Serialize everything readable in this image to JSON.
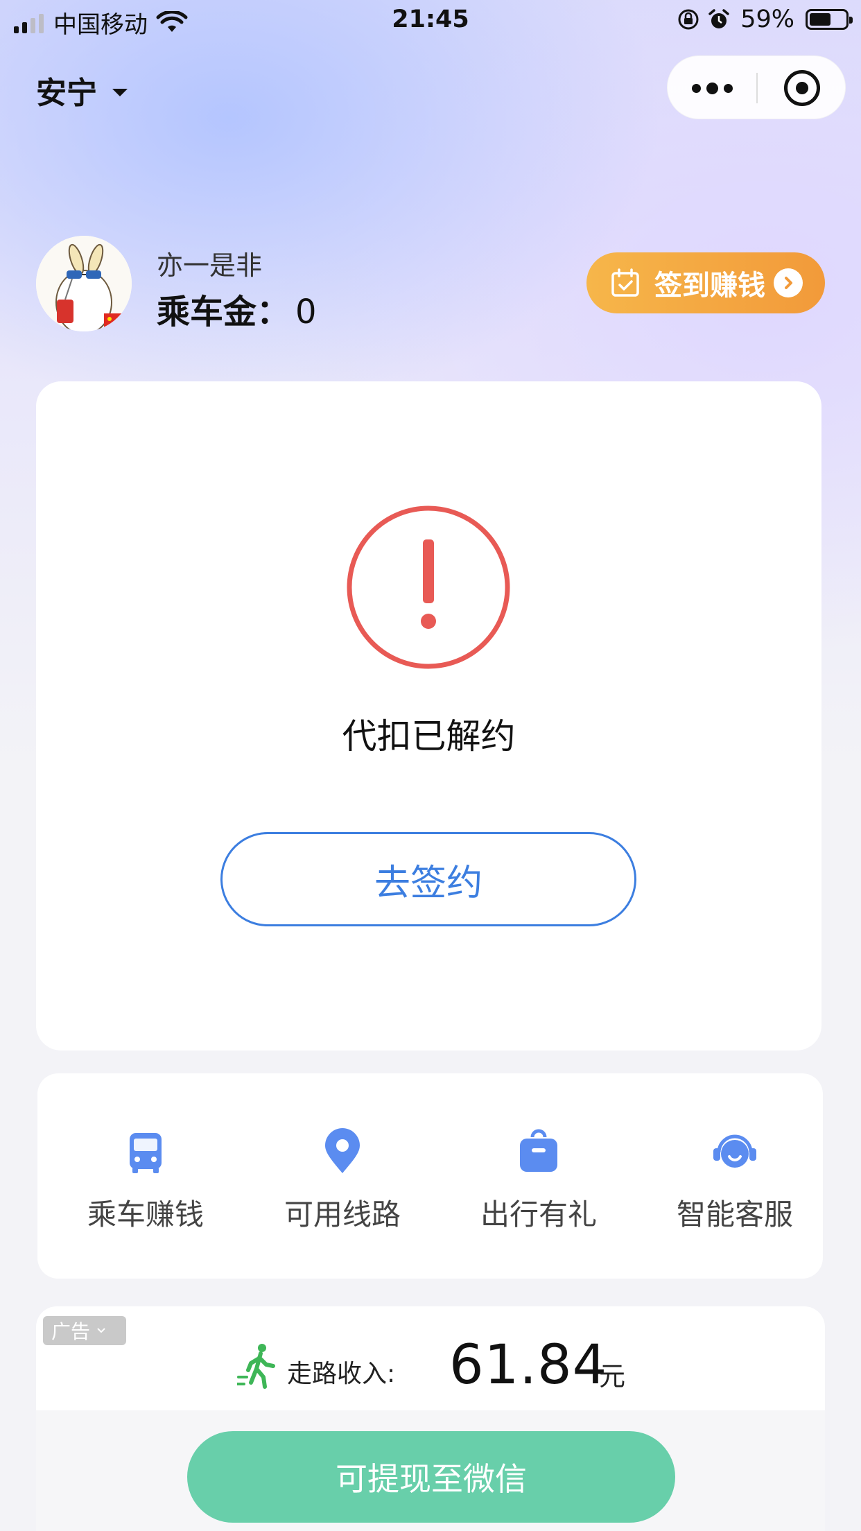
{
  "status_bar": {
    "carrier": "中国移动",
    "time": "21:45",
    "battery_pct": "59%",
    "battery_level": 0.59
  },
  "header": {
    "city": "安宁"
  },
  "user": {
    "name": "亦一是非",
    "coin_label": "乘车金：",
    "coin_value": "0",
    "signin_label": "签到赚钱"
  },
  "main_card": {
    "status_text": "代扣已解约",
    "sign_button": "去签约"
  },
  "nav": {
    "items": [
      {
        "label": "乘车赚钱",
        "icon": "bus-icon"
      },
      {
        "label": "可用线路",
        "icon": "location-pin-icon"
      },
      {
        "label": "出行有礼",
        "icon": "gift-bag-icon"
      },
      {
        "label": "智能客服",
        "icon": "customer-service-icon"
      }
    ]
  },
  "earnings": {
    "ad_tag": "广告",
    "label": "走路收入:",
    "value": "61.84",
    "unit": "元",
    "withdraw_button": "可提现至微信"
  },
  "colors": {
    "accent_blue": "#3c7ee0",
    "warning_red": "#e85a55",
    "signin_orange": "#f29a3a",
    "withdraw_green": "#68cfaa",
    "icon_blue": "#5b8cf0"
  }
}
